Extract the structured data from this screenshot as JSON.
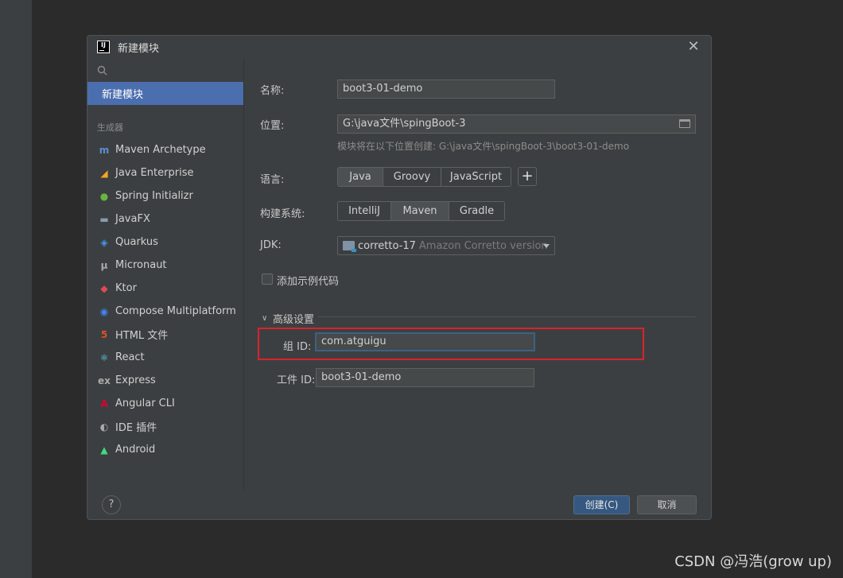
{
  "dialog": {
    "title": "新建模块",
    "logo_text": "IJ"
  },
  "sidebar": {
    "selected": "新建模块",
    "section_label": "生成器",
    "items": [
      {
        "label": "Maven Archetype",
        "icon": "m",
        "color": "#5c8dd6"
      },
      {
        "label": "Java Enterprise",
        "icon": "◢",
        "color": "#f5a623"
      },
      {
        "label": "Spring Initializr",
        "icon": "●",
        "color": "#6db33f"
      },
      {
        "label": "JavaFX",
        "icon": "▬",
        "color": "#8a9bb0"
      },
      {
        "label": "Quarkus",
        "icon": "◈",
        "color": "#4695eb"
      },
      {
        "label": "Micronaut",
        "icon": "μ",
        "color": "#aaaaaa"
      },
      {
        "label": "Ktor",
        "icon": "◆",
        "color": "#e44857"
      },
      {
        "label": "Compose Multiplatform",
        "icon": "◉",
        "color": "#4285f4"
      },
      {
        "label": "HTML 文件",
        "icon": "5",
        "color": "#e34f26"
      },
      {
        "label": "React",
        "icon": "⚛",
        "color": "#61dafb"
      },
      {
        "label": "Express",
        "icon": "ex",
        "color": "#aaaaaa"
      },
      {
        "label": "Angular CLI",
        "icon": "A",
        "color": "#dd0031"
      },
      {
        "label": "IDE 插件",
        "icon": "◐",
        "color": "#aaaaaa"
      },
      {
        "label": "Android",
        "icon": "▲",
        "color": "#3ddc84"
      }
    ]
  },
  "form": {
    "name_label": "名称:",
    "name_value": "boot3-01-demo",
    "location_label": "位置:",
    "location_value": "G:\\java文件\\spingBoot-3",
    "location_hint": "模块将在以下位置创建: G:\\java文件\\spingBoot-3\\boot3-01-demo",
    "language_label": "语言:",
    "languages": [
      "Java",
      "Groovy",
      "JavaScript"
    ],
    "language_selected": "Java",
    "add_language": "+",
    "build_label": "构建系统:",
    "builds": [
      "IntelliJ",
      "Maven",
      "Gradle"
    ],
    "build_selected": "Maven",
    "jdk_label": "JDK:",
    "jdk_value": "corretto-17",
    "jdk_detail": "Amazon Corretto version",
    "sample_code_label": "添加示例代码",
    "advanced_label": "高级设置",
    "group_id_label": "组 ID:",
    "group_id_value": "com.atguigu",
    "artifact_id_label": "工件 ID:",
    "artifact_id_value": "boot3-01-demo"
  },
  "footer": {
    "help": "?",
    "create": "创建(C)",
    "cancel": "取消"
  },
  "watermark": "CSDN @冯浩(grow up)",
  "colors": {
    "accent": "#4b6eaf",
    "highlight": "#d9232b",
    "primary_button": "#365880"
  }
}
